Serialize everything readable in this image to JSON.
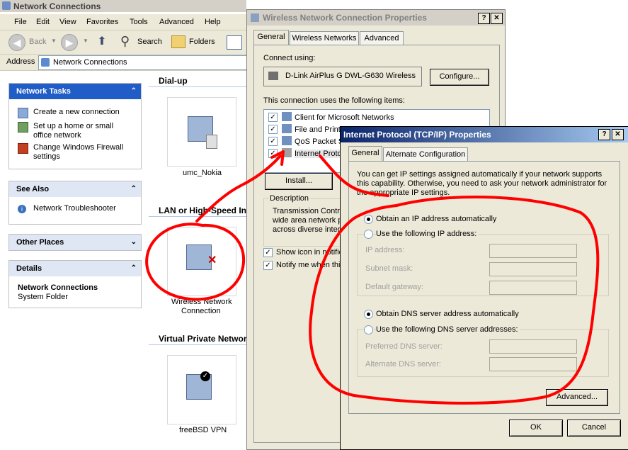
{
  "explorer": {
    "title": "Network Connections",
    "menu": [
      "File",
      "Edit",
      "View",
      "Favorites",
      "Tools",
      "Advanced",
      "Help"
    ],
    "toolbar": {
      "back": "Back",
      "search": "Search",
      "folders": "Folders"
    },
    "address": {
      "label": "Address",
      "value": "Network Connections"
    },
    "network_tasks": {
      "title": "Network Tasks",
      "items": [
        "Create a new connection",
        "Set up a home or small office network",
        "Change Windows Firewall settings"
      ]
    },
    "see_also": {
      "title": "See Also",
      "items": [
        "Network Troubleshooter"
      ]
    },
    "other_places": {
      "title": "Other Places"
    },
    "details": {
      "title": "Details",
      "name": "Network Connections",
      "type": "System Folder"
    },
    "sections": {
      "dialup": "Dial-up",
      "lan": "LAN or High-Speed Int",
      "vpn": "Virtual Private Network"
    },
    "connections": {
      "umc": "umc_Nokia",
      "wireless_line1": "Wireless Network",
      "wireless_line2": "Connection",
      "vpn": "freeBSD VPN"
    }
  },
  "wireless_dialog": {
    "title": "Wireless Network Connection Properties",
    "tabs": [
      "General",
      "Wireless Networks",
      "Advanced"
    ],
    "connect_using_label": "Connect using:",
    "adapter": "D-Link AirPlus G DWL-G630 Wireless",
    "configure_button": "Configure...",
    "items_label": "This connection uses the following items:",
    "items": [
      "Client for Microsoft Networks",
      "File and Printe",
      "QoS Packet S",
      "Internet Proto"
    ],
    "install_button": "Install...",
    "description_label": "Description",
    "description_lines": [
      "Transmission Contro",
      "wide area network p",
      "across diverse interc"
    ],
    "show_icon": "Show icon in notific",
    "notify_me": "Notify me when this"
  },
  "tcpip_dialog": {
    "title": "Internet Protocol (TCP/IP) Properties",
    "tabs": [
      "General",
      "Alternate Configuration"
    ],
    "intro_line1": "You can get IP settings assigned automatically if your network supports",
    "intro_line2": "this capability. Otherwise, you need to ask your network administrator for",
    "intro_line3": "the appropriate IP settings.",
    "obtain_ip": "Obtain an IP address automatically",
    "use_ip": "Use the following IP address:",
    "ip_address": "IP address:",
    "subnet_mask": "Subnet mask:",
    "default_gateway": "Default gateway:",
    "obtain_dns": "Obtain DNS server address automatically",
    "use_dns": "Use the following DNS server addresses:",
    "preferred_dns": "Preferred DNS server:",
    "alternate_dns": "Alternate DNS server:",
    "advanced_button": "Advanced...",
    "ok_button": "OK",
    "cancel_button": "Cancel"
  },
  "colors": {
    "xp_title_blue": "#0a246a",
    "annotation_red": "#ff0000",
    "task_blue": "#215dc6",
    "dialog_face": "#ece9d8"
  }
}
